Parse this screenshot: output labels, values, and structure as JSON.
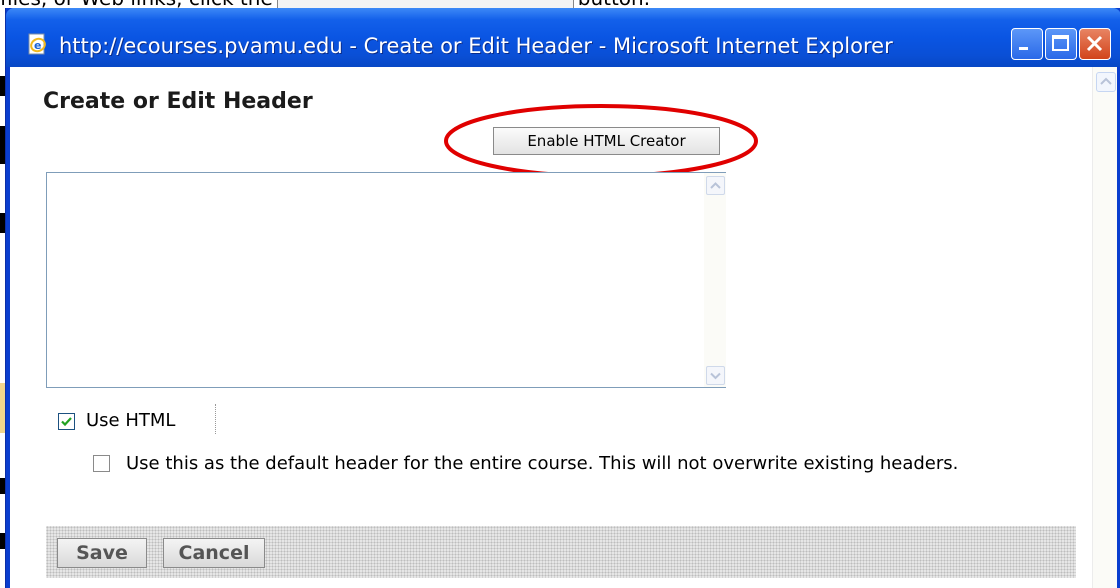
{
  "background_doc": {
    "text_before": "files, or Web links, click the",
    "text_after": "button."
  },
  "window": {
    "title": "http://ecourses.pvamu.edu - Create or Edit Header - Microsoft Internet Explorer",
    "icon": "ie-page-icon",
    "controls": [
      "minimize",
      "maximize",
      "close"
    ]
  },
  "page": {
    "heading": "Create or Edit Header",
    "enable_html_creator_label": "Enable HTML Creator",
    "highlight_color": "#e00000",
    "editor_value": "",
    "use_html_label": "Use HTML",
    "use_html_checked": true,
    "default_header_label": "Use this as the default header for the entire course. This will not overwrite existing headers.",
    "default_header_checked": false,
    "save_label": "Save",
    "cancel_label": "Cancel"
  },
  "colors": {
    "titlebar": "#0a55e3",
    "close_button": "#d2441b",
    "checkmark": "#21a121"
  }
}
